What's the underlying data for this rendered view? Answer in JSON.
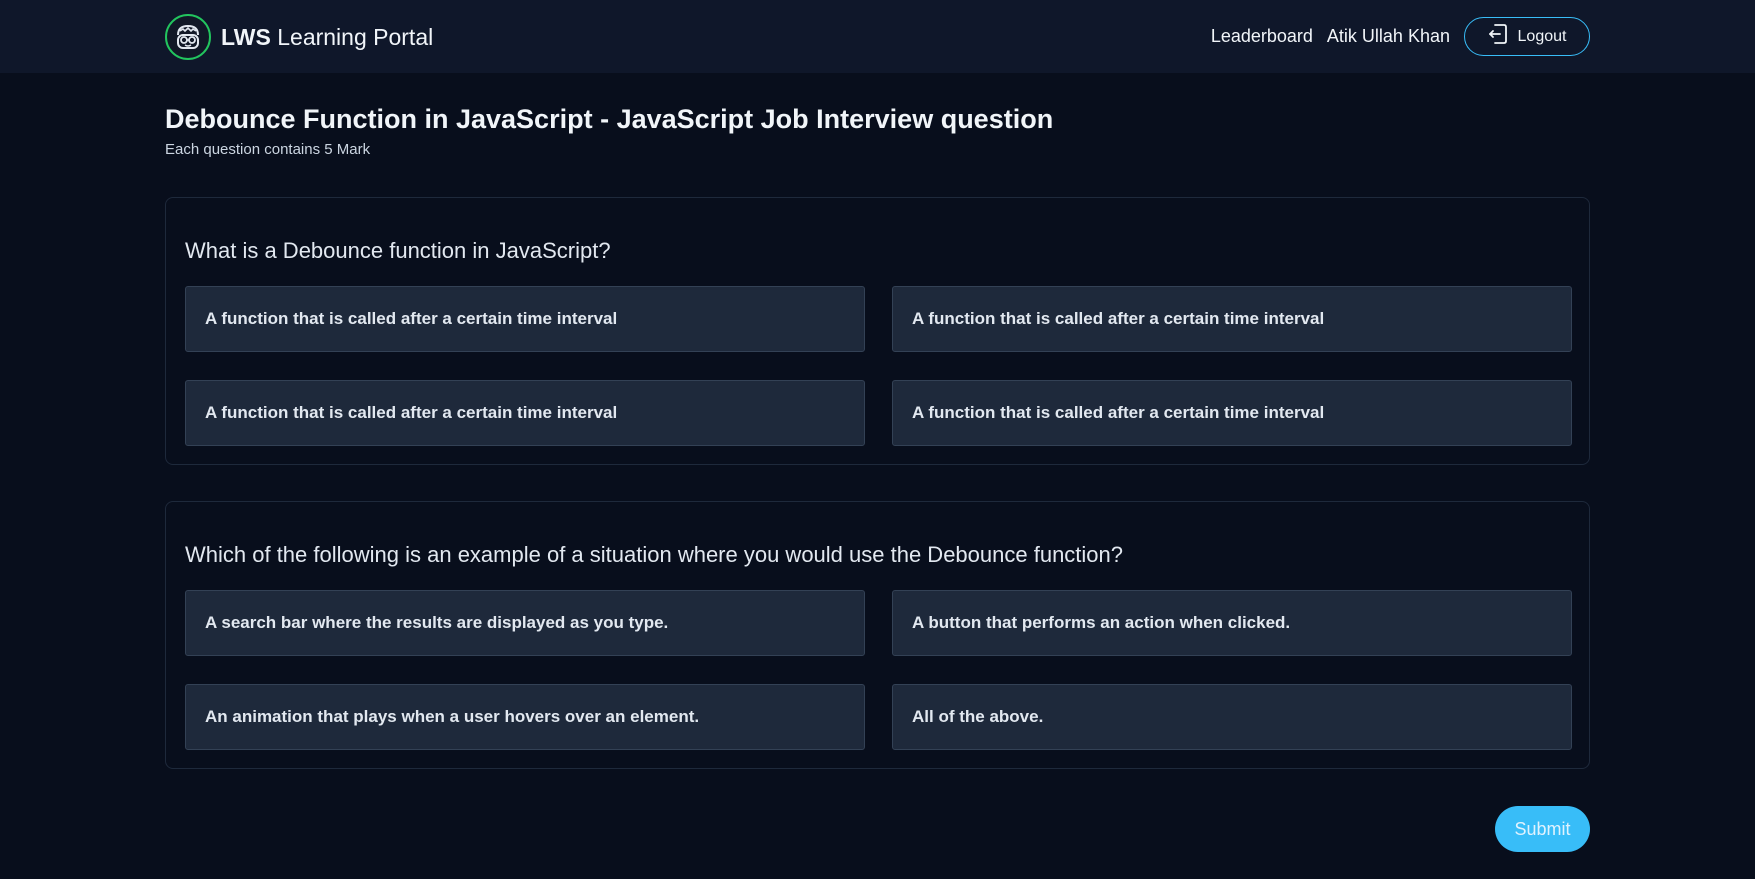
{
  "header": {
    "brand_bold": "LWS",
    "brand_rest": " Learning Portal",
    "logo_icon": "nerd-glasses-avatar-icon",
    "nav": {
      "leaderboard": "Leaderboard",
      "user_name": "Atik Ullah Khan",
      "logout": "Logout",
      "logout_icon": "logout-icon"
    }
  },
  "quiz": {
    "title": "Debounce Function in JavaScript - JavaScript Job Interview question",
    "subtitle": "Each question contains 5 Mark",
    "questions": [
      {
        "text": "What is a Debounce function in JavaScript?",
        "options": [
          "A function that is called after a certain time interval",
          "A function that is called after a certain time interval",
          "A function that is called after a certain time interval",
          "A function that is called after a certain time interval"
        ]
      },
      {
        "text": "Which of the following is an example of a situation where you would use the Debounce function?",
        "options": [
          "A search bar where the results are displayed as you type.",
          "A button that performs an action when clicked.",
          "An animation that plays when a user hovers over an element.",
          "All of the above."
        ]
      }
    ],
    "submit_label": "Submit"
  },
  "colors": {
    "background": "#080e1c",
    "navbar": "#0f172a",
    "option_bg": "#1e293b",
    "accent": "#38bdf8",
    "logo_ring": "#22c55e"
  }
}
